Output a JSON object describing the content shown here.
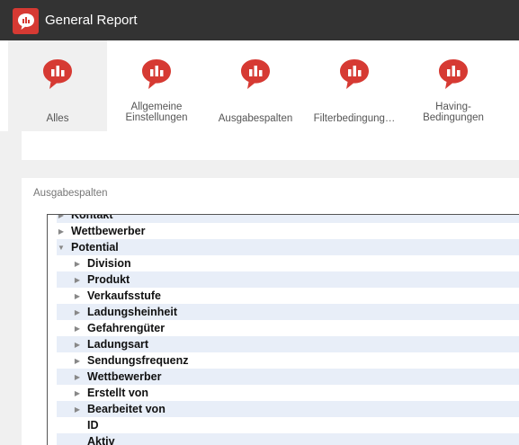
{
  "app": {
    "title": "General Report",
    "accent": "#d63a33",
    "logo_icon": "report-chat-icon"
  },
  "ribbon": {
    "tabs": [
      {
        "label": "Alles",
        "icon": "report-chat-icon",
        "active": true
      },
      {
        "label": "Allgemeine\nEinstellungen",
        "icon": "report-chat-icon",
        "active": false
      },
      {
        "label": "Ausgabespalten",
        "icon": "report-chat-icon",
        "active": false
      },
      {
        "label": "Filterbedingung…",
        "icon": "report-chat-icon",
        "active": false
      },
      {
        "label": "Having-\nBedingungen",
        "icon": "report-chat-icon",
        "active": false
      }
    ]
  },
  "panel": {
    "caption": "Ausgabespalten"
  },
  "tree": {
    "rows": [
      {
        "label": "Kontakt",
        "expander": "collapsed",
        "level": 0
      },
      {
        "label": "Wettbewerber",
        "expander": "collapsed",
        "level": 0
      },
      {
        "label": "Potential",
        "expander": "expanded",
        "level": 0
      },
      {
        "label": "Division",
        "expander": "collapsed",
        "level": 1
      },
      {
        "label": "Produkt",
        "expander": "collapsed",
        "level": 1
      },
      {
        "label": "Verkaufsstufe",
        "expander": "collapsed",
        "level": 1
      },
      {
        "label": "Ladungsheinheit",
        "expander": "collapsed",
        "level": 1
      },
      {
        "label": "Gefahrengüter",
        "expander": "collapsed",
        "level": 1
      },
      {
        "label": "Ladungsart",
        "expander": "collapsed",
        "level": 1
      },
      {
        "label": "Sendungsfrequenz",
        "expander": "collapsed",
        "level": 1
      },
      {
        "label": "Wettbewerber",
        "expander": "collapsed",
        "level": 1
      },
      {
        "label": "Erstellt von",
        "expander": "collapsed",
        "level": 1
      },
      {
        "label": "Bearbeitet von",
        "expander": "collapsed",
        "level": 1
      },
      {
        "label": "ID",
        "expander": "none",
        "level": 1
      },
      {
        "label": "Aktiv",
        "expander": "none",
        "level": 1
      }
    ]
  }
}
